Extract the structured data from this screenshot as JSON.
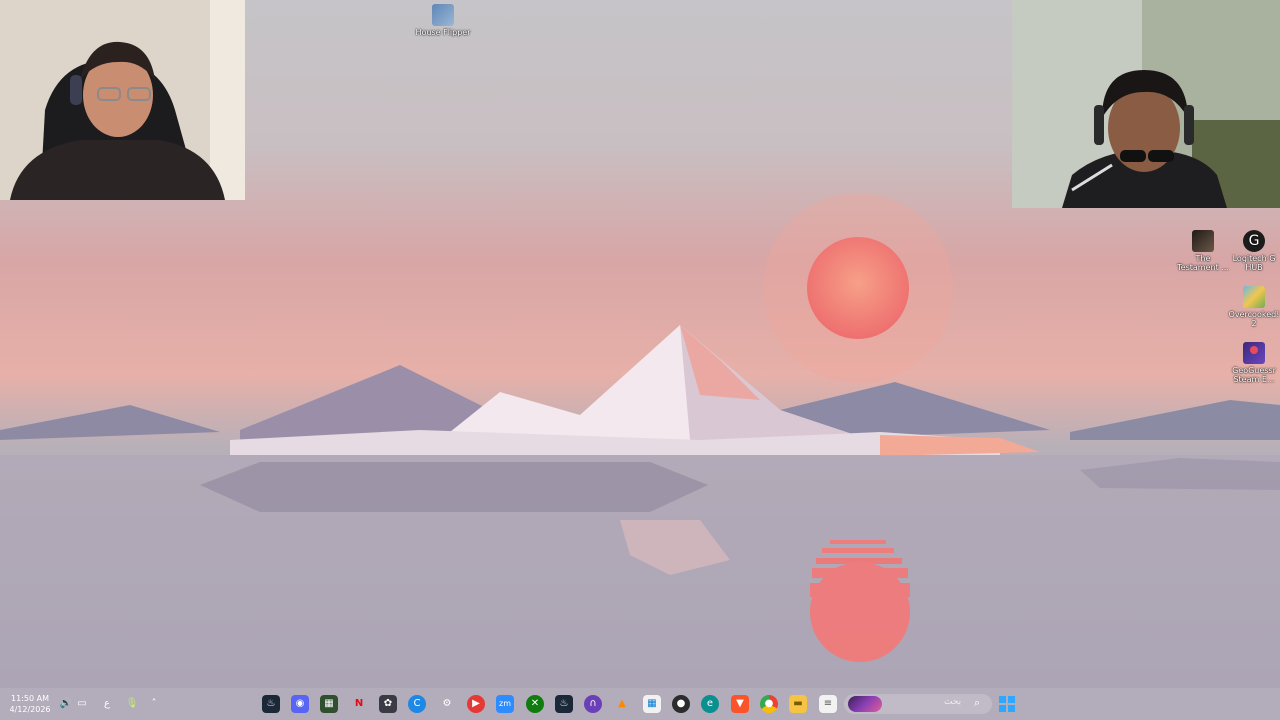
{
  "desktop_icons": [
    {
      "label": "House Flipper",
      "icon": "house-flipper-shortcut-icon"
    },
    {
      "label": "The Testament ...",
      "icon": "the-testament-shortcut-icon"
    },
    {
      "label": "Logitech G HUB",
      "icon": "logitech-ghub-shortcut-icon"
    },
    {
      "label": "Overcooked! 2",
      "icon": "overcooked2-shortcut-icon"
    },
    {
      "label": "GeoGuessr Steam E...",
      "icon": "geoguessr-shortcut-icon"
    }
  ],
  "taskbar": {
    "clock_time": "11:50 AM",
    "clock_date": "4/12/2026",
    "input_language": "ع",
    "search_placeholder": "بحث",
    "apps": [
      "steam-icon",
      "discord-icon",
      "photo-editor-icon",
      "netflix-icon",
      "davinci-resolve-icon",
      "cursor-app-icon",
      "steelseries-icon",
      "youtube-music-icon",
      "zoom-icon",
      "xbox-icon",
      "steam-icon",
      "audio-app-icon",
      "vlc-icon",
      "microsoft-store-icon",
      "obs-icon",
      "edge-icon",
      "brave-icon",
      "chrome-icon",
      "file-explorer-icon",
      "notepad-icon"
    ]
  },
  "colors": {
    "sun": "#f1807a",
    "taskbar_tint": "#b9b2be",
    "start_blue": "#2ea8ff"
  }
}
